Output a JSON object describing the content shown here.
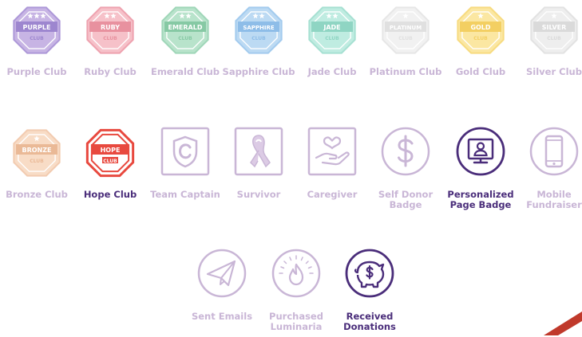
{
  "club_badges": [
    {
      "id": "purple",
      "label": "Purple Club",
      "banner": "PURPLE",
      "club": "CLUB",
      "stars": 3,
      "fill": "#c7b4e4",
      "stroke": "#ad98d8",
      "banner_color": "#9d86cf"
    },
    {
      "id": "ruby",
      "label": "Ruby Club",
      "banner": "RUBY",
      "club": "CLUB",
      "stars": 2,
      "fill": "#f6c1c9",
      "stroke": "#eea2af",
      "banner_color": "#e8919f"
    },
    {
      "id": "emerald",
      "label": "Emerald Club",
      "banner": "EMERALD",
      "club": "CLUB",
      "stars": 2,
      "fill": "#b8e3cb",
      "stroke": "#9fd6b8",
      "banner_color": "#86c9a4"
    },
    {
      "id": "sapphire",
      "label": "Sapphire Club",
      "banner": "SAPPHIRE",
      "club": "CLUB",
      "stars": 2,
      "fill": "#bcdaf3",
      "stroke": "#a3cbee",
      "banner_color": "#8ebde8"
    },
    {
      "id": "jade",
      "label": "Jade Club",
      "banner": "JADE",
      "club": "CLUB",
      "stars": 2,
      "fill": "#bfece1",
      "stroke": "#a6e0d2",
      "banner_color": "#8fd5c3"
    },
    {
      "id": "platinum",
      "label": "Platinum Club",
      "banner": "PLATINUM",
      "club": "CLUB",
      "stars": 1,
      "fill": "#f1f1f1",
      "stroke": "#e6e6e6",
      "banner_color": "#e0e0e0"
    },
    {
      "id": "gold",
      "label": "Gold Club",
      "banner": "GOLD",
      "club": "CLUB",
      "stars": 1,
      "fill": "#fbe7a2",
      "stroke": "#f7db80",
      "banner_color": "#f3cf62"
    },
    {
      "id": "silver",
      "label": "Silver Club",
      "banner": "SILVER",
      "club": "CLUB",
      "stars": 1,
      "fill": "#eeeeee",
      "stroke": "#e2e2e2",
      "banner_color": "#dadada"
    },
    {
      "id": "bronze",
      "label": "Bronze Club",
      "banner": "BRONZE",
      "club": "CLUB",
      "stars": 1,
      "fill": "#f8dcc6",
      "stroke": "#f2cbb0",
      "banner_color": "#eab996"
    },
    {
      "id": "hope",
      "label": "Hope Club",
      "banner": "HOPE",
      "club": "CLUB",
      "stars": 0,
      "fill": "#ffffff",
      "stroke": "#e8493f",
      "banner_color": "#e8493f",
      "active": true
    }
  ],
  "icon_badges": [
    {
      "id": "team-captain",
      "label": "Team Captain",
      "icon": "shield-c-icon",
      "active": false
    },
    {
      "id": "survivor",
      "label": "Survivor",
      "icon": "ribbon-icon",
      "active": false
    },
    {
      "id": "caregiver",
      "label": "Caregiver",
      "icon": "heart-hand-icon",
      "active": false
    },
    {
      "id": "self-donor",
      "label": "Self Donor Badge",
      "icon": "dollar-circle-icon",
      "active": false
    },
    {
      "id": "personalized-page",
      "label": "Personalized Page Badge",
      "icon": "monitor-person-icon",
      "active": true
    },
    {
      "id": "mobile-fundraiser",
      "label": "Mobile Fundraiser",
      "icon": "phone-icon",
      "active": false
    },
    {
      "id": "sent-emails",
      "label": "Sent Emails",
      "icon": "paper-plane-icon",
      "active": false
    },
    {
      "id": "purchased-luminaria",
      "label": "Purchased Luminaria",
      "icon": "flame-icon",
      "active": false
    },
    {
      "id": "received-donations",
      "label": "Received Donations",
      "icon": "piggy-bank-icon",
      "active": true
    }
  ],
  "colors": {
    "faded": "#c9b6d6",
    "active": "#4a2d7a",
    "accent_corner": "#c0392b"
  }
}
